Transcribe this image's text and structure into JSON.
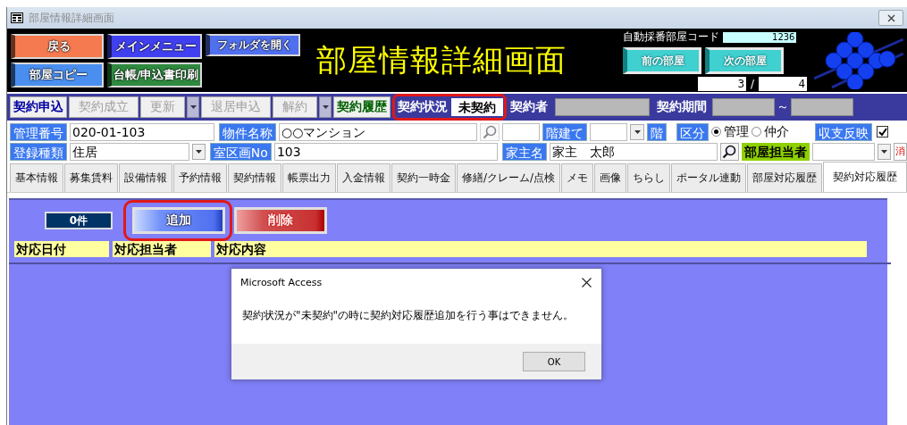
{
  "window": {
    "title": "部屋情報詳細画面"
  },
  "header": {
    "buttons": [
      {
        "label": "戻る",
        "color": "#f57a50"
      },
      {
        "label": "メインメニュー",
        "color": "#4040f0"
      },
      {
        "label": "フォルダを開く",
        "color": "#5070f0"
      },
      {
        "label": "部屋コピー",
        "color": "#4a8ff0"
      },
      {
        "label": "台帳/申込書印刷",
        "color": "#2e8a3e"
      }
    ],
    "title": "部屋情報詳細画面",
    "room_code": {
      "label": "自動採番部屋コード",
      "value": "1236"
    },
    "nav_buttons": [
      "前の部屋",
      "次の部屋"
    ],
    "record": {
      "current": "3",
      "separator": "/",
      "total": "4"
    }
  },
  "contract_bar": {
    "actions": [
      {
        "kind": "button",
        "label": "契約申込",
        "disabled": false,
        "color": "#0000a0"
      },
      {
        "kind": "button",
        "label": "契約成立",
        "disabled": true
      },
      {
        "kind": "button",
        "label": "更新",
        "disabled": true
      },
      {
        "kind": "dropdown",
        "disabled": true
      },
      {
        "kind": "button",
        "label": "退居申込",
        "disabled": true
      },
      {
        "kind": "button",
        "label": "解約",
        "disabled": true
      },
      {
        "kind": "dropdown",
        "disabled": true
      },
      {
        "kind": "button",
        "label": "契約履歴",
        "disabled": false,
        "color": "#006000"
      }
    ],
    "status": {
      "label": "契約状況",
      "value": "未契約",
      "highlighted": true
    },
    "contractor": {
      "label": "契約者"
    },
    "period": {
      "label": "契約期間",
      "separator": "～"
    }
  },
  "fields": {
    "management_no": {
      "label": "管理番号",
      "value": "020-01-103"
    },
    "property_name": {
      "label": "物件名称",
      "value": "○○マンション"
    },
    "floors": {
      "label": "階建て",
      "suffix": "階"
    },
    "category": {
      "label": "区分",
      "options": [
        {
          "label": "管理",
          "selected": true
        },
        {
          "label": "仲介",
          "selected": false
        }
      ]
    },
    "income_reflect": {
      "label": "収支反映",
      "checked": true
    },
    "registration_type": {
      "label": "登録種類",
      "value": "住居"
    },
    "unit_no": {
      "label": "室区画No",
      "value": "103"
    },
    "owner": {
      "label": "家主名",
      "value": "家主　太郎"
    },
    "room_staff": {
      "label": "部屋担当者",
      "clear": "消"
    }
  },
  "tabs": [
    {
      "label": "基本情報",
      "selected": false
    },
    {
      "label": "募集賃料",
      "selected": false
    },
    {
      "label": "設備情報",
      "selected": false
    },
    {
      "label": "予約情報",
      "selected": false
    },
    {
      "label": "契約情報",
      "selected": false
    },
    {
      "label": "帳票出力",
      "selected": false
    },
    {
      "label": "入金情報",
      "selected": false
    },
    {
      "label": "契約一時金",
      "selected": false
    },
    {
      "label": "修繕/クレーム/点検",
      "selected": false
    },
    {
      "label": "メモ",
      "selected": false
    },
    {
      "label": "画像",
      "selected": false
    },
    {
      "label": "ちらし",
      "selected": false
    },
    {
      "label": "ポータル連動",
      "selected": false
    },
    {
      "label": "部屋対応履歴",
      "selected": false
    },
    {
      "label": "契約対応履歴",
      "selected": true
    }
  ],
  "history": {
    "count": "0件",
    "buttons": [
      {
        "kind": "add",
        "label": "追加",
        "highlighted": true
      },
      {
        "kind": "delete",
        "label": "削除",
        "highlighted": false
      }
    ],
    "columns": [
      "対応日付",
      "対応担当者",
      "対応内容"
    ]
  },
  "dialog": {
    "title": "Microsoft Access",
    "message": "契約状況が\"未契約\"の時に契約対応履歴追加を行う事はできません。",
    "button": "OK"
  }
}
